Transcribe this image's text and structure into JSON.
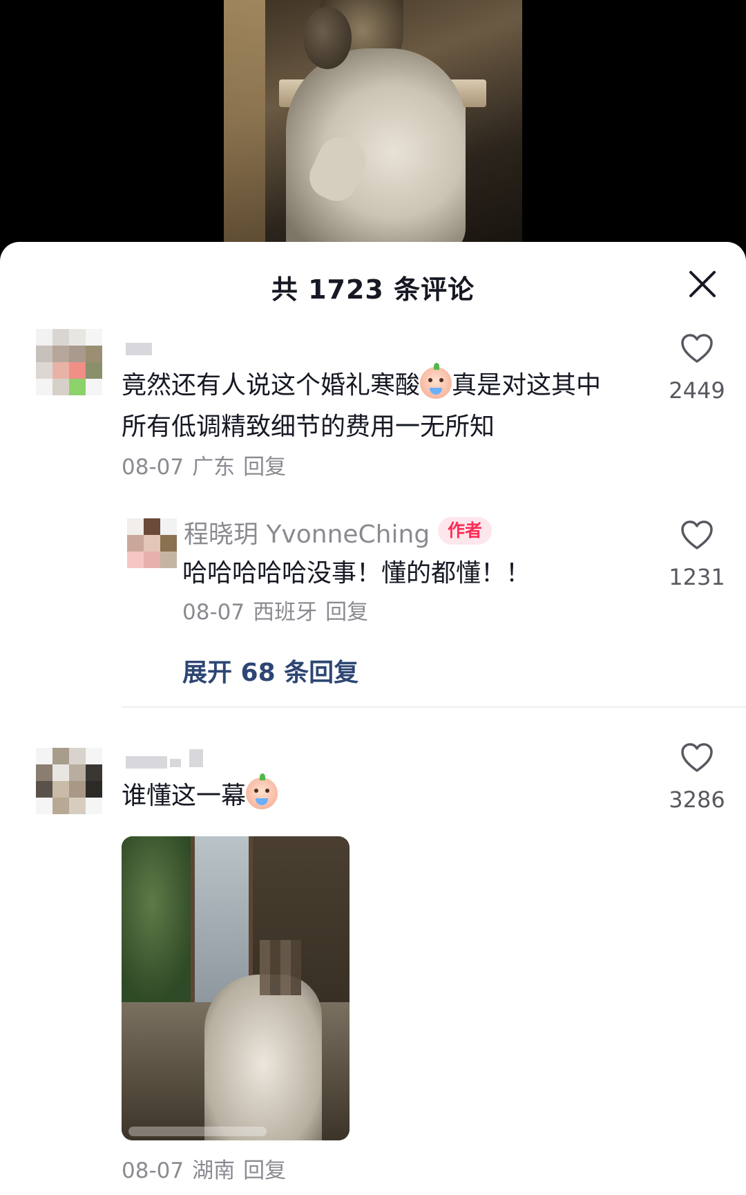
{
  "sheet": {
    "title": "共 1723 条评论"
  },
  "comments": [
    {
      "text_before": "竟然还有人说这个婚礼寒酸",
      "text_after": "真是对这其中所有低调精致细节的费用一无所知",
      "date": "08-07",
      "location": "广东",
      "reply_label": "回复",
      "likes": "2449"
    },
    {
      "username": "程晓玥 YvonneChing",
      "badge": "作者",
      "text": "哈哈哈哈哈没事！懂的都懂！！",
      "date": "08-07",
      "location": "西班牙",
      "reply_label": "回复",
      "likes": "1231",
      "expand_label": "展开 68 条回复"
    },
    {
      "text": "谁懂这一幕",
      "date": "08-07",
      "location": "湖南",
      "reply_label": "回复",
      "likes": "3286"
    }
  ],
  "icons": {
    "like": "heart-outline-icon",
    "close": "close-icon",
    "emoji": "crying-baby-emoji"
  },
  "colors": {
    "author_badge": "#fe2c55",
    "expand_link": "#2d4673",
    "meta_text": "#8a8b91"
  }
}
